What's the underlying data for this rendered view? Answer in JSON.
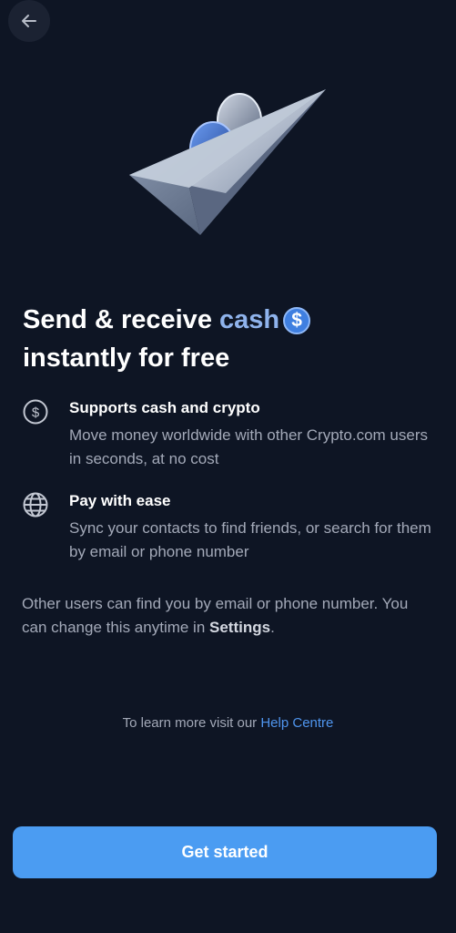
{
  "nav": {
    "back_icon": "arrow-left-icon"
  },
  "hero": {
    "icon": "paper-plane-with-coins-illustration"
  },
  "headline": {
    "part1": "Send & receive",
    "accent": "cash",
    "badge_symbol": "$",
    "part2": "instantly for free"
  },
  "features": [
    {
      "icon": "dollar-circle-icon",
      "title": "Supports cash and crypto",
      "description": "Move money worldwide with other Crypto.com users in seconds, at no cost"
    },
    {
      "icon": "globe-icon",
      "title": "Pay with ease",
      "description": "Sync your contacts to find friends, or search for them by email or phone number"
    }
  ],
  "note": {
    "text": "Other users can find you by email or phone number. You can change this anytime in ",
    "settings_link": "Settings",
    "suffix": "."
  },
  "help": {
    "prefix": "To learn more visit our ",
    "link": "Help Centre"
  },
  "cta": {
    "label": "Get started"
  },
  "colors": {
    "background": "#0e1524",
    "accent": "#4b9cf2",
    "link": "#4f95ee",
    "muted_text": "#a3a9b8"
  }
}
